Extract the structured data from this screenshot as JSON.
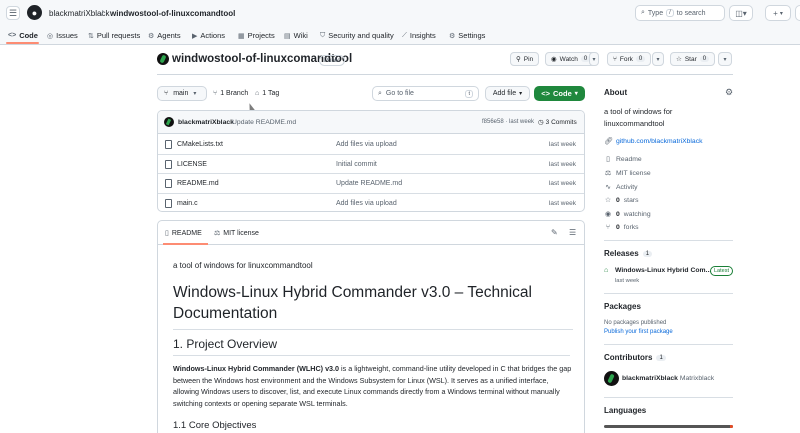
{
  "header": {
    "owner": "blackmatriXblack",
    "separator": "/",
    "repo": "windwostool-of-linuxcomandtool",
    "search_placeholder": "Type",
    "search_key": "/",
    "search_suffix": "to search",
    "plus_label": "+",
    "plus_caret": "▾"
  },
  "nav": {
    "tabs": [
      {
        "label": "Code",
        "icon": "code-icon"
      },
      {
        "label": "Issues",
        "icon": "issue-icon"
      },
      {
        "label": "Pull requests",
        "icon": "pull-request-icon"
      },
      {
        "label": "Agents",
        "icon": "agents-icon"
      },
      {
        "label": "Actions",
        "icon": "actions-icon"
      },
      {
        "label": "Projects",
        "icon": "projects-icon"
      },
      {
        "label": "Wiki",
        "icon": "wiki-icon"
      },
      {
        "label": "Security and quality",
        "icon": "shield-icon"
      },
      {
        "label": "Insights",
        "icon": "graph-icon"
      },
      {
        "label": "Settings",
        "icon": "gear-icon"
      }
    ]
  },
  "repo": {
    "title": "windwostool-of-linuxcomandtool",
    "visibility": "Public",
    "pin_label": "Pin",
    "watch_label": "Watch",
    "watch_count": "0",
    "fork_label": "Fork",
    "fork_count": "0",
    "star_label": "Star",
    "star_count": "0"
  },
  "toolbar": {
    "branch": "main",
    "branches": "1 Branch",
    "tags": "1 Tag",
    "goto_placeholder": "Go to file",
    "goto_key": "t",
    "add_file": "Add file",
    "code": "Code"
  },
  "commit": {
    "author": "blackmatriXblack",
    "message": "Update README.md",
    "hash": "f856e58 · last week",
    "count": "3 Commits"
  },
  "files": [
    {
      "name": "CMakeLists.txt",
      "message": "Add files via upload",
      "time": "last week"
    },
    {
      "name": "LICENSE",
      "message": "Initial commit",
      "time": "last week"
    },
    {
      "name": "README.md",
      "message": "Update README.md",
      "time": "last week"
    },
    {
      "name": "main.c",
      "message": "Add files via upload",
      "time": "last week"
    }
  ],
  "readme": {
    "tab_readme": "README",
    "tab_license": "MIT license",
    "tagline": "a tool of windows for linuxcommandtool",
    "h1": "Windows-Linux Hybrid Commander v3.0 – Technical Documentation",
    "h2": "1. Project Overview",
    "p_bold": "Windows-Linux Hybrid Commander (WLHC) v3.0",
    "p_rest": " is a lightweight, command-line utility developed in C that bridges the gap between the Windows host environment and the Windows Subsystem for Linux (WSL). It serves as a unified interface, allowing Windows users to discover, list, and execute Linux commands directly from a Windows terminal without manually switching contexts or opening separate WSL terminals.",
    "h3": "1.1 Core Objectives"
  },
  "sidebar": {
    "about_title": "About",
    "description": "a tool of windows for linuxcommandtool",
    "link": "github.com/blackmatriXblack",
    "items": {
      "readme": "Readme",
      "license": "MIT license",
      "activity": "Activity",
      "stars_num": "0",
      "stars_label": "stars",
      "watching_num": "0",
      "watching_label": "watching",
      "forks_num": "0",
      "forks_label": "forks"
    },
    "releases_title": "Releases",
    "releases_count": "1",
    "release_name": "Windows-Linux Hybrid Com...",
    "release_badge": "Latest",
    "release_time": "last week",
    "packages_title": "Packages",
    "packages_none": "No packages published",
    "packages_link": "Publish your first package",
    "contributors_title": "Contributors",
    "contributors_count": "1",
    "contributor_name": "blackmatriXblack",
    "contributor_handle": "Matrixblack",
    "languages_title": "Languages"
  },
  "colors": {
    "accent_green": "#1f883d",
    "tab_underline": "#fd8c73",
    "link_blue": "#0969da"
  }
}
